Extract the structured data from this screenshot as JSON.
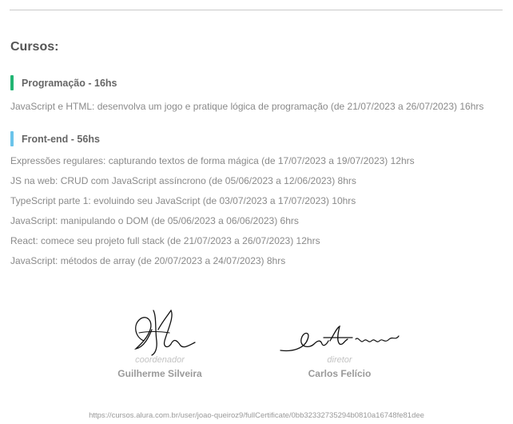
{
  "section_title": "Cursos:",
  "groups": [
    {
      "name": "Programação - 16hs",
      "bar_color": "#22b573",
      "courses": [
        "JavaScript e HTML: desenvolva um jogo e pratique lógica de programação (de 21/07/2023 a 26/07/2023) 16hrs"
      ]
    },
    {
      "name": "Front-end - 56hs",
      "bar_color": "#6bc4ea",
      "courses": [
        "Expressões regulares: capturando textos de forma mágica (de 17/07/2023 a 19/07/2023) 12hrs",
        "JS na web: CRUD com JavaScript assíncrono (de 05/06/2023 a 12/06/2023) 8hrs",
        "TypeScript parte 1: evoluindo seu JavaScript (de 03/07/2023 a 17/07/2023) 10hrs",
        "JavaScript: manipulando o DOM (de 05/06/2023 a 06/06/2023) 6hrs",
        "React: comece seu projeto full stack (de 21/07/2023 a 26/07/2023) 12hrs",
        "JavaScript: métodos de array (de 20/07/2023 a 24/07/2023) 8hrs"
      ]
    }
  ],
  "signatures": [
    {
      "role": "coordenador",
      "name": "Guilherme Silveira"
    },
    {
      "role": "diretor",
      "name": "Carlos Felício"
    }
  ],
  "url": "https://cursos.alura.com.br/user/joao-queiroz9/fullCertificate/0bb32332735294b0810a16748fe81dee"
}
